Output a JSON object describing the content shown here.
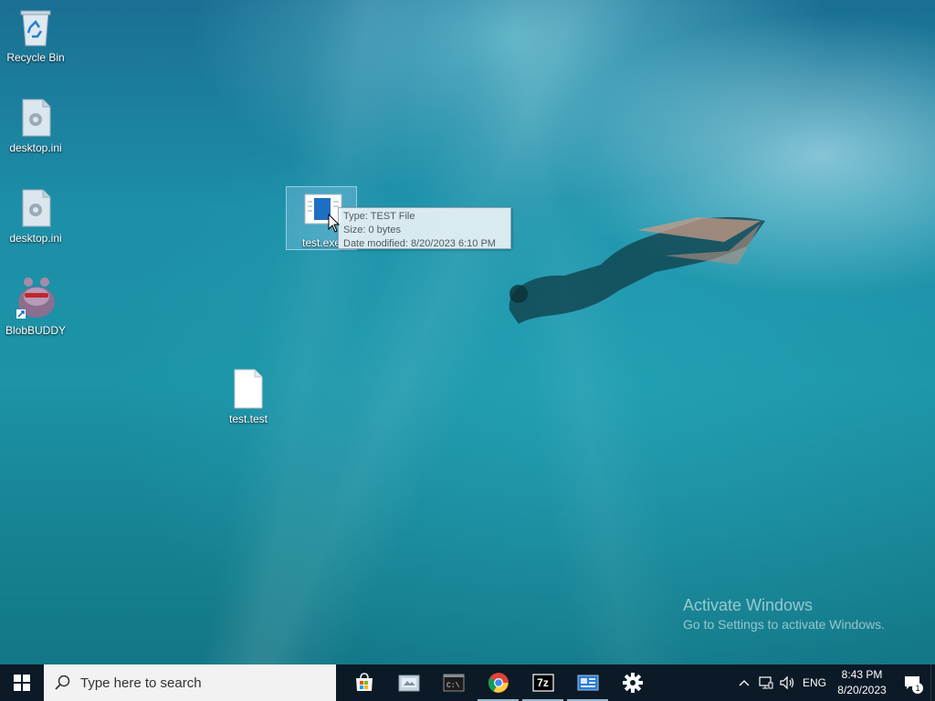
{
  "desktop": {
    "icons": [
      {
        "label": "Recycle Bin",
        "icon": "recycle-bin-icon"
      },
      {
        "label": "desktop.ini",
        "icon": "settings-file-icon"
      },
      {
        "label": "desktop.ini",
        "icon": "settings-file-icon"
      },
      {
        "label": "BlobBUDDY",
        "icon": "blobbuddy-icon"
      },
      {
        "label": "test.test",
        "icon": "blank-file-icon"
      },
      {
        "label": "test.exe",
        "icon": "application-file-icon"
      }
    ],
    "tooltip": {
      "type": "Type: TEST File",
      "size": "Size: 0 bytes",
      "modified": "Date modified: 8/20/2023 6:10 PM"
    },
    "watermark": {
      "title": "Activate Windows",
      "subtitle": "Go to Settings to activate Windows."
    }
  },
  "taskbar": {
    "search_placeholder": "Type here to search",
    "pinned": [
      {
        "name": "Microsoft Store",
        "icon": "store-icon"
      },
      {
        "name": "File Explorer",
        "icon": "explorer-icon"
      },
      {
        "name": "Command Prompt",
        "icon": "cmd-icon"
      },
      {
        "name": "Google Chrome",
        "icon": "chrome-icon"
      },
      {
        "name": "7-Zip",
        "icon": "7zip-icon",
        "text": "7z"
      },
      {
        "name": "Control Panel",
        "icon": "control-panel-icon"
      },
      {
        "name": "Settings",
        "icon": "gear-icon"
      }
    ],
    "tray": {
      "language": "ENG",
      "time": "8:43 PM",
      "date": "8/20/2023",
      "notification_count": "1"
    }
  },
  "colors": {
    "taskbar_bg": "#0b1a26",
    "search_bg": "#f2f2f2",
    "tooltip_bg": "#e8f1f6"
  }
}
